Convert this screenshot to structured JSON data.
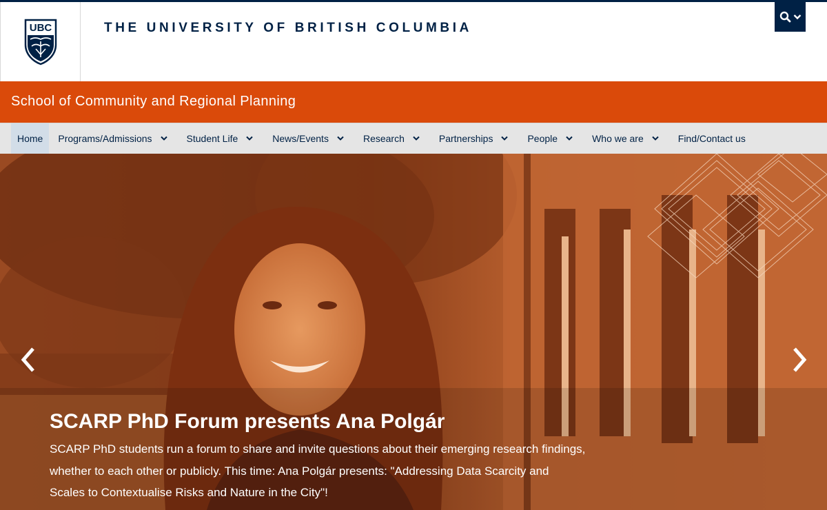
{
  "header": {
    "logo_text": "UBC",
    "university_name": "THE UNIVERSITY OF BRITISH COLUMBIA"
  },
  "unit": {
    "name": "School of Community and Regional Planning"
  },
  "nav": {
    "items": [
      {
        "label": "Home"
      },
      {
        "label": "Programs/Admissions"
      },
      {
        "label": "Student Life"
      },
      {
        "label": "News/Events"
      },
      {
        "label": "Research"
      },
      {
        "label": "Partnerships"
      },
      {
        "label": "People"
      },
      {
        "label": "Who we are"
      },
      {
        "label": "Find/Contact us"
      }
    ]
  },
  "carousel": {
    "title": "SCARP PhD Forum presents Ana Polgár",
    "description": "SCARP PhD students run a forum to share and invite questions about their emerging research findings, whether to each other or publicly. This time: Ana Polgár presents: \"Addressing Data Scarcity and Scales to Contextualise Risks and Nature in the City\"!"
  },
  "colors": {
    "ubc_blue": "#002145",
    "unit_orange": "#da4a0a",
    "nav_bg": "#e5e5e5",
    "nav_active": "#d2dde8"
  },
  "icons": {
    "search": "search-icon",
    "chevron": "chevron-down-icon",
    "prev": "chevron-left-icon",
    "next": "chevron-right-icon"
  }
}
